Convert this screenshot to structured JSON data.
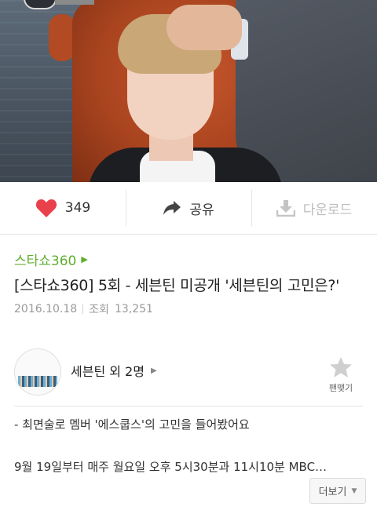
{
  "video": {
    "thumbnail": "variety-show-still"
  },
  "actions": {
    "like": {
      "icon": "heart-icon",
      "count": "349",
      "color": "#e8414b"
    },
    "share": {
      "icon": "share-arrow-icon",
      "label": "공유"
    },
    "download": {
      "icon": "download-icon",
      "label": "다운로드",
      "enabled": false
    }
  },
  "info": {
    "channel": "스타쇼360",
    "title": "[스타쇼360] 5회 - 세븐틴 미공개 '세븐틴의 고민은?'",
    "date": "2016.10.18",
    "views_label": "조회",
    "views": "13,251"
  },
  "artist": {
    "name": "세븐틴 외 2명",
    "fan_label": "팬맺기",
    "fan_icon": "star-icon"
  },
  "description": {
    "line1": "- 최면술로 멤버 '에스쿱스'의 고민을 들어봤어요",
    "line2": "9월 19일부터 매주 월요일 오후 5시30분과 11시10분 MBC…"
  },
  "more_button": {
    "label": "더보기"
  },
  "colors": {
    "accent_green": "#5fae2e",
    "heart_red": "#e8414b",
    "disabled_gray": "#bdbdbd"
  }
}
